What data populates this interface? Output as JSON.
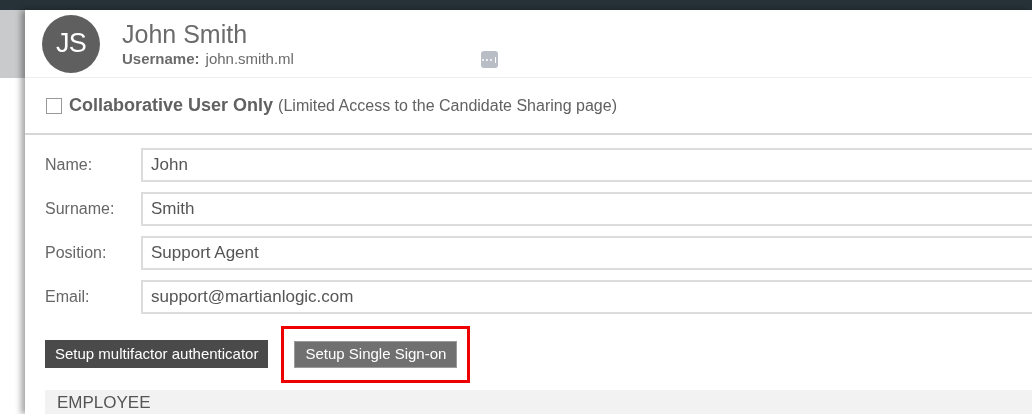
{
  "user": {
    "initials": "JS",
    "full_name": "John Smith",
    "username_label": "Username:",
    "username": "john.smith.ml"
  },
  "collaborative": {
    "label": "Collaborative User Only",
    "note": "(Limited Access to the Candidate Sharing page)",
    "checked": false
  },
  "fields": [
    {
      "label": "Name:",
      "value": "John"
    },
    {
      "label": "Surname:",
      "value": "Smith"
    },
    {
      "label": "Position:",
      "value": "Support Agent"
    },
    {
      "label": "Email:",
      "value": "support@martianlogic.com"
    }
  ],
  "buttons": [
    {
      "label": "Setup multifactor authenticator",
      "kind": "dark",
      "highlighted": false
    },
    {
      "label": "Setup Single Sign-on",
      "kind": "mid",
      "highlighted": true
    }
  ],
  "section": {
    "title": "EMPLOYEE"
  }
}
